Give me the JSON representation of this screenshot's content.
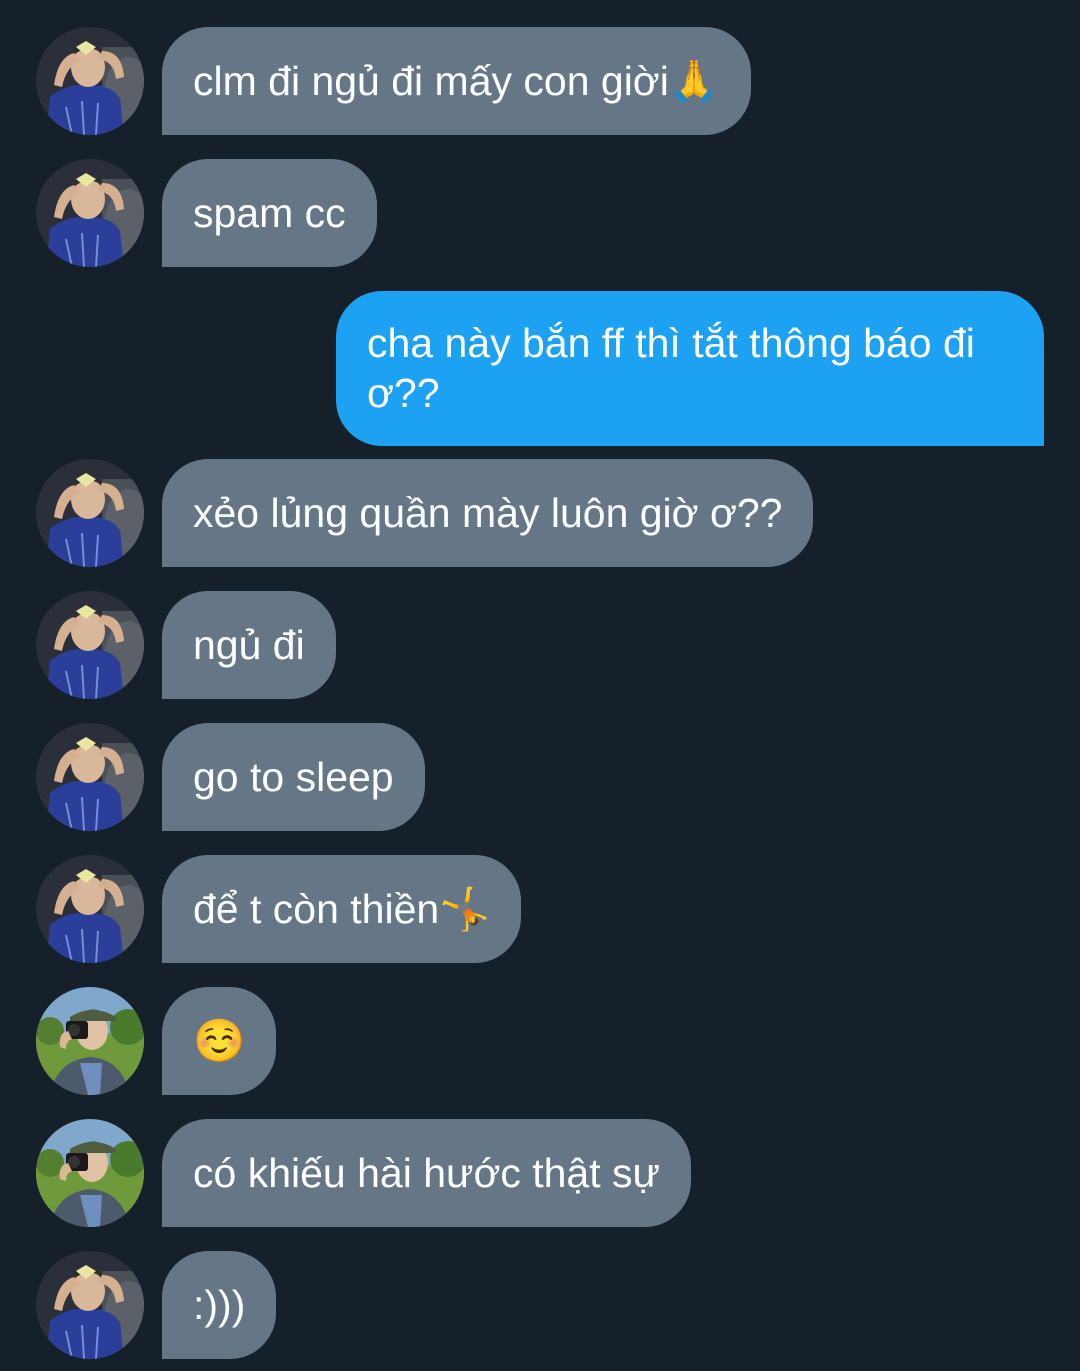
{
  "conversation": {
    "messages": [
      {
        "sender": "contact_a",
        "text": "clm đi ngủ đi mấy con giời🙏"
      },
      {
        "sender": "contact_a",
        "text": "spam cc"
      },
      {
        "sender": "me",
        "text": "cha này bắn ff thì tắt thông báo đi ơ??"
      },
      {
        "sender": "contact_a",
        "text": "xẻo lủng quần mày luôn giờ ơ??"
      },
      {
        "sender": "contact_a",
        "text": "ngủ đi"
      },
      {
        "sender": "contact_a",
        "text": "go to sleep"
      },
      {
        "sender": "contact_a",
        "text": "để t còn thiền🤸"
      },
      {
        "sender": "contact_b",
        "text": "☺️"
      },
      {
        "sender": "contact_b",
        "text": "có khiếu hài hước thật sự"
      },
      {
        "sender": "contact_a",
        "text": ":)))"
      }
    ]
  },
  "colors": {
    "background": "#15202b",
    "incoming_bubble": "#657786",
    "outgoing_bubble": "#1da1f2",
    "text": "#ffffff"
  },
  "icons": {
    "avatar_a": "avatar-photo-hands-frame-icon",
    "avatar_b": "avatar-photo-camera-park-icon"
  }
}
